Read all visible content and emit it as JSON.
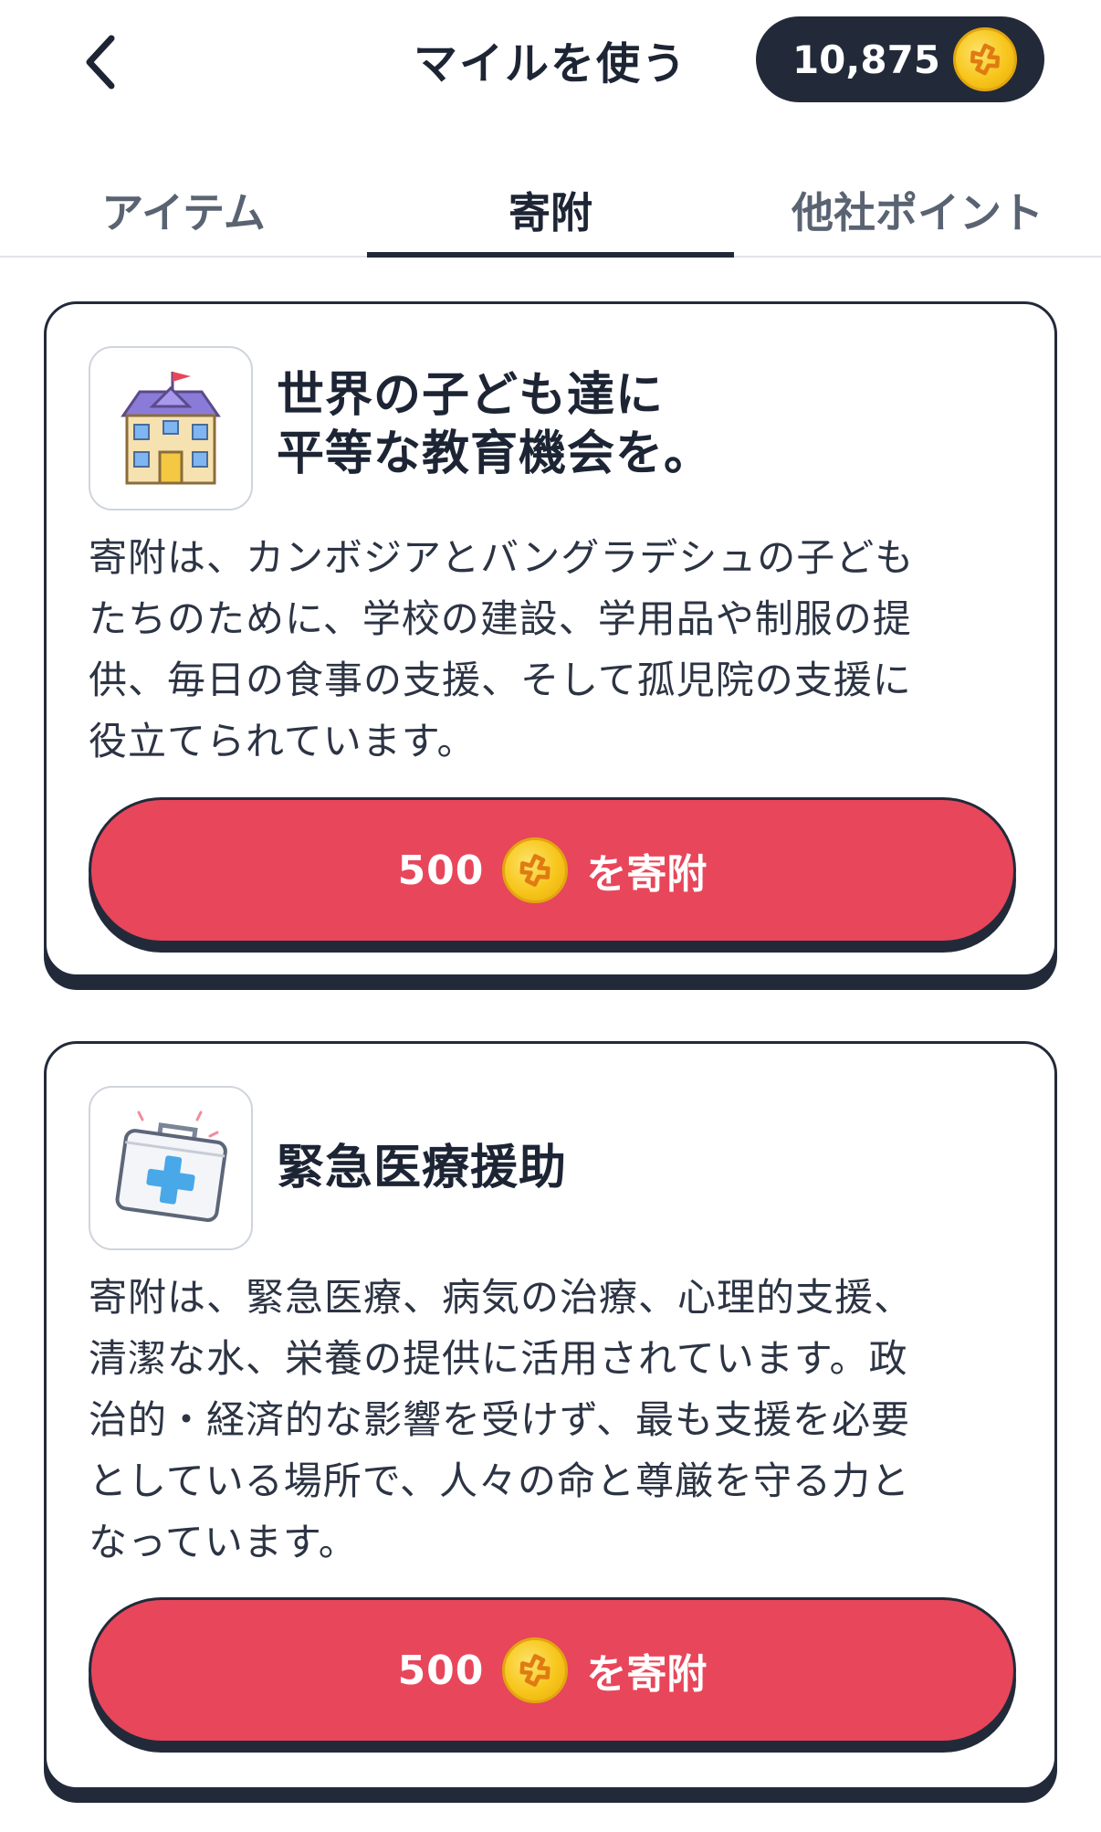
{
  "header": {
    "title": "マイルを使う",
    "back_icon": "chevron-left-icon",
    "balance": "10,875",
    "coin_icon": "shuriken-coin-icon"
  },
  "tabs": [
    {
      "label": "アイテム",
      "active": false
    },
    {
      "label": "寄附",
      "active": true
    },
    {
      "label": "他社ポイント",
      "active": false
    }
  ],
  "cards": [
    {
      "icon": "school-building-icon",
      "title_line1": "世界の子ども達に",
      "title_line2": "平等な教育機会を。",
      "desc_lines": [
        "寄附は、カンボジアとバングラデシュの子ども",
        "たちのために、学校の建設、学用品や制服の提",
        "供、毎日の食事の支援、そして孤児院の支援に",
        "役立てられています。"
      ],
      "button_amount": "500",
      "button_suffix": "を寄附"
    },
    {
      "icon": "first-aid-kit-icon",
      "title_line1": "緊急医療援助",
      "desc_lines": [
        "寄附は、緊急医療、病気の治療、心理的支援、",
        "清潔な水、栄養の提供に活用されています。政",
        "治的・経済的な影響を受けず、最も支援を必要",
        "としている場所で、人々の命と尊厳を守る力と",
        "なっています。"
      ],
      "button_amount": "500",
      "button_suffix": "を寄附"
    }
  ],
  "colors": {
    "navy": "#222a3a",
    "button_red": "#e8465a",
    "coin_gold": "#f7c61c"
  }
}
